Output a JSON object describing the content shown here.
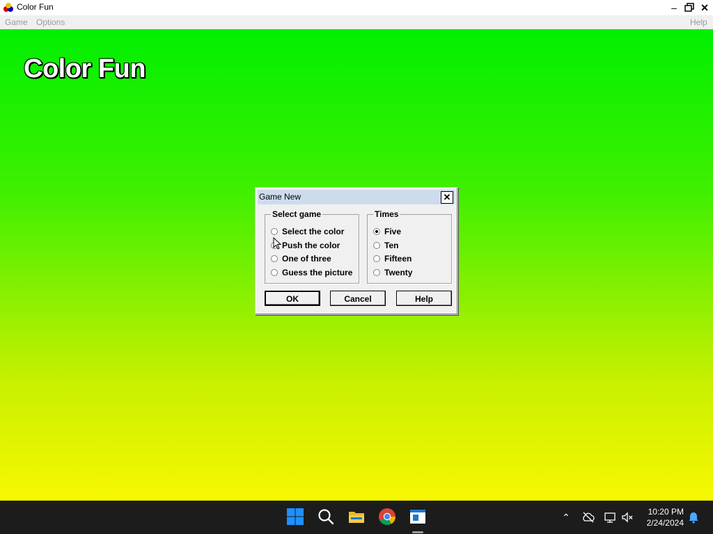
{
  "window": {
    "title": "Color Fun",
    "icon": "color-balls-icon",
    "controls": {
      "minimize": "minimize-icon",
      "restore": "restore-icon",
      "close": "close-icon"
    }
  },
  "menu": {
    "game": "Game",
    "options": "Options",
    "help": "Help"
  },
  "game": {
    "title": "Color Fun",
    "colors": {
      "top": "#00f000",
      "bottom": "#f8f800"
    }
  },
  "dialog": {
    "title": "Game New",
    "select_game": {
      "legend": "Select game",
      "options": [
        "Select the color",
        "Push the color",
        "One of three",
        "Guess the picture"
      ],
      "selected": null
    },
    "times": {
      "legend": "Times",
      "options": [
        "Five",
        "Ten",
        "Fifteen",
        "Twenty"
      ],
      "selected": "Five"
    },
    "buttons": {
      "ok": "OK",
      "cancel": "Cancel",
      "help": "Help"
    }
  },
  "taskbar": {
    "apps": [
      "start-icon",
      "search-icon",
      "file-explorer-icon",
      "chrome-icon",
      "color-fun-app-icon"
    ],
    "tray": [
      "chevron-up-icon",
      "cloud-offline-icon",
      "network-icon",
      "volume-muted-icon",
      "notification-bell-icon"
    ],
    "time": "10:20 PM",
    "date": "2/24/2024"
  }
}
